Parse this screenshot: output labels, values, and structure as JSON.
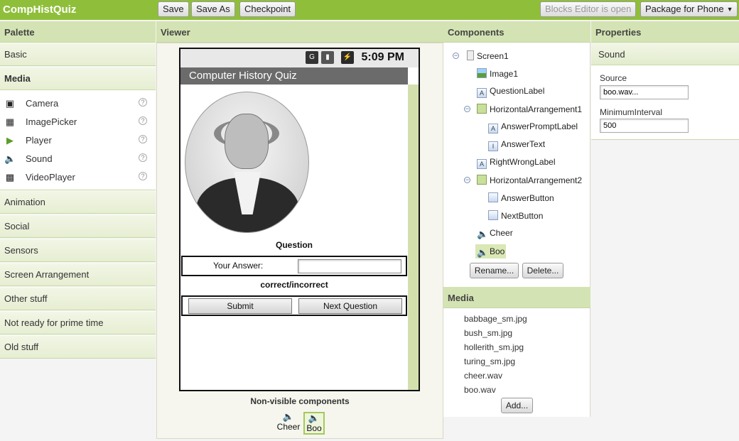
{
  "app": {
    "title": "CompHistQuiz",
    "toolbar": {
      "save": "Save",
      "save_as": "Save As",
      "checkpoint": "Checkpoint"
    },
    "blocks_editor": "Blocks Editor is open",
    "package": "Package for Phone",
    "accent_color": "#8fbf3a"
  },
  "palette": {
    "header": "Palette",
    "categories": [
      "Basic",
      "Media",
      "Animation",
      "Social",
      "Sensors",
      "Screen Arrangement",
      "Other stuff",
      "Not ready for prime time",
      "Old stuff"
    ],
    "media_items": [
      {
        "label": "Camera",
        "icon": "camera-icon"
      },
      {
        "label": "ImagePicker",
        "icon": "image-picker-icon"
      },
      {
        "label": "Player",
        "icon": "player-icon"
      },
      {
        "label": "Sound",
        "icon": "sound-icon"
      },
      {
        "label": "VideoPlayer",
        "icon": "video-player-icon"
      }
    ],
    "help": "?"
  },
  "viewer": {
    "header": "Viewer",
    "status_time": "5:09 PM",
    "screen_title": "Computer History Quiz",
    "question": "Question",
    "answer_prompt": "Your Answer:",
    "answer_value": "",
    "right_wrong": "correct/incorrect",
    "submit": "Submit",
    "next_question": "Next Question",
    "nonvisible_header": "Non-visible components",
    "nonvisible": [
      "Cheer",
      "Boo"
    ]
  },
  "components": {
    "header": "Components",
    "tree": [
      {
        "label": "Screen1",
        "icon": "screen-icon",
        "toggle": "⊖"
      },
      {
        "label": "Image1",
        "icon": "image-icon"
      },
      {
        "label": "QuestionLabel",
        "icon": "label-icon"
      },
      {
        "label": "HorizontalArrangement1",
        "icon": "horizontal-arrangement-icon",
        "toggle": "⊖"
      },
      {
        "label": "AnswerPromptLabel",
        "icon": "label-icon"
      },
      {
        "label": "AnswerText",
        "icon": "textbox-icon"
      },
      {
        "label": "RightWrongLabel",
        "icon": "label-icon"
      },
      {
        "label": "HorizontalArrangement2",
        "icon": "horizontal-arrangement-icon",
        "toggle": "⊖"
      },
      {
        "label": "AnswerButton",
        "icon": "button-icon"
      },
      {
        "label": "NextButton",
        "icon": "button-icon"
      },
      {
        "label": "Cheer",
        "icon": "sound-icon"
      },
      {
        "label": "Boo",
        "icon": "sound-icon",
        "selected": true
      }
    ],
    "rename": "Rename...",
    "delete": "Delete..."
  },
  "media": {
    "header": "Media",
    "files": [
      "babbage_sm.jpg",
      "bush_sm.jpg",
      "hollerith_sm.jpg",
      "turing_sm.jpg",
      "cheer.wav",
      "boo.wav"
    ],
    "add": "Add..."
  },
  "properties": {
    "header": "Properties",
    "component": "Sound",
    "source_label": "Source",
    "source_value": "boo.wav...",
    "min_interval_label": "MinimumInterval",
    "min_interval_value": "500"
  }
}
